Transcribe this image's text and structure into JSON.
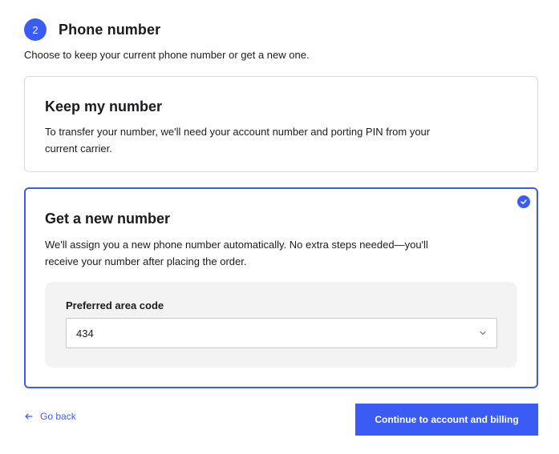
{
  "step": {
    "number": "2",
    "title": "Phone number",
    "subtitle": "Choose to keep your current phone number or get a new one."
  },
  "options": [
    {
      "title": "Keep my number",
      "description": "To transfer your number, we'll need your account number and porting PIN from your current carrier.",
      "selected": false
    },
    {
      "title": "Get a new number",
      "description": "We'll assign you a new phone number automatically. No extra steps needed—you'll receive your number after placing the order.",
      "selected": true
    }
  ],
  "area_code": {
    "label": "Preferred area code",
    "value": "434"
  },
  "footer": {
    "back_label": "Go back",
    "continue_label": "Continue to account and billing"
  },
  "icons": {
    "selected": "check-circle-icon",
    "dropdown": "chevron-down-icon",
    "back": "arrow-left-icon"
  },
  "colors": {
    "accent": "#3b5bf5",
    "panel": "#f3f3f4"
  }
}
